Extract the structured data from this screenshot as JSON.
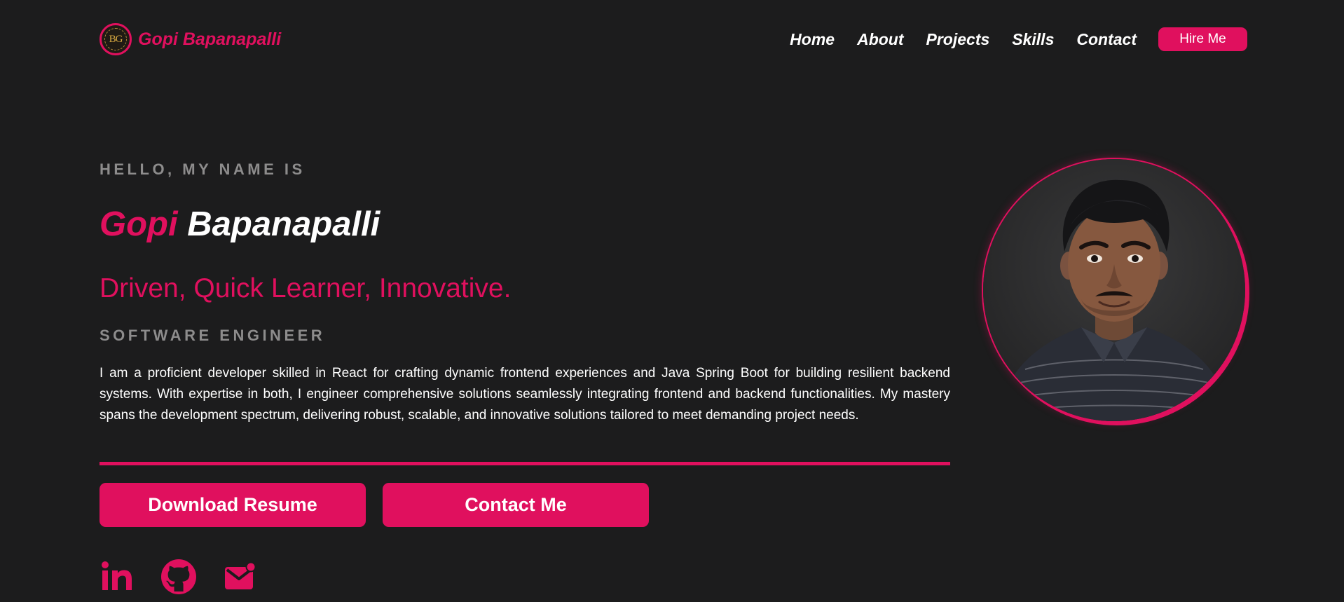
{
  "brand": {
    "logo_text": "BG",
    "name": "Gopi Bapanapalli"
  },
  "nav": {
    "items": [
      {
        "label": "Home"
      },
      {
        "label": "About"
      },
      {
        "label": "Projects"
      },
      {
        "label": "Skills"
      },
      {
        "label": "Contact"
      }
    ],
    "hire_label": "Hire Me"
  },
  "hero": {
    "eyebrow": "HELLO, MY NAME IS",
    "first_name": "Gopi",
    "last_name": "Bapanapalli",
    "tagline": "Driven, Quick Learner, Innovative.",
    "role": "SOFTWARE ENGINEER",
    "bio": "I am a proficient developer skilled in React for crafting dynamic frontend experiences and Java Spring Boot for building resilient backend systems. With expertise in both, I engineer comprehensive solutions seamlessly integrating frontend and backend functionalities. My mastery spans the development spectrum, delivering robust, scalable, and innovative solutions tailored to meet demanding project needs.",
    "download_label": "Download Resume",
    "contact_label": "Contact Me"
  },
  "socials": [
    {
      "icon": "linkedin-icon"
    },
    {
      "icon": "github-icon"
    },
    {
      "icon": "email-icon"
    }
  ],
  "colors": {
    "background": "#1c1c1d",
    "accent": "#e0105e",
    "muted": "#8d8c8c",
    "text": "#ffffff"
  }
}
